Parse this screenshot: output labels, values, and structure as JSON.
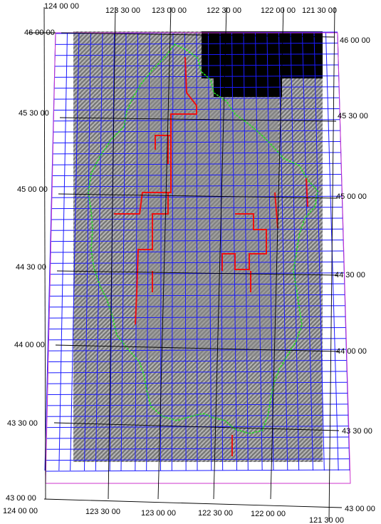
{
  "map": {
    "labels": {
      "top": [
        "124 00 00",
        "123 30 00",
        "123 00 00",
        "122 30 00",
        "122 00 00",
        "121 30 00"
      ],
      "bottom": [
        "124 00 00",
        "123 30 00",
        "123 00 00",
        "122 30 00",
        "122 00 00",
        "121 30 00"
      ],
      "left": [
        "46 00 00",
        "45 30 00",
        "45 00 00",
        "44 30 00",
        "44 00 00",
        "43 30 00",
        "43 00 00"
      ],
      "right": [
        "46 00 00",
        "45 30 00",
        "45 00 00",
        "44 30 00",
        "44 00 00",
        "43 30 00",
        "43 00 00"
      ]
    },
    "colors": {
      "background": "#ffffff",
      "hillshade": "#8e8e8e",
      "nodata": "#000000",
      "tile_grid": "#1a1aff",
      "boundary": "#22dd22",
      "red_lines": "#ee1111",
      "frame": "#cc33cc",
      "graticule": "#000000",
      "tile_text": "#cccc22"
    }
  }
}
